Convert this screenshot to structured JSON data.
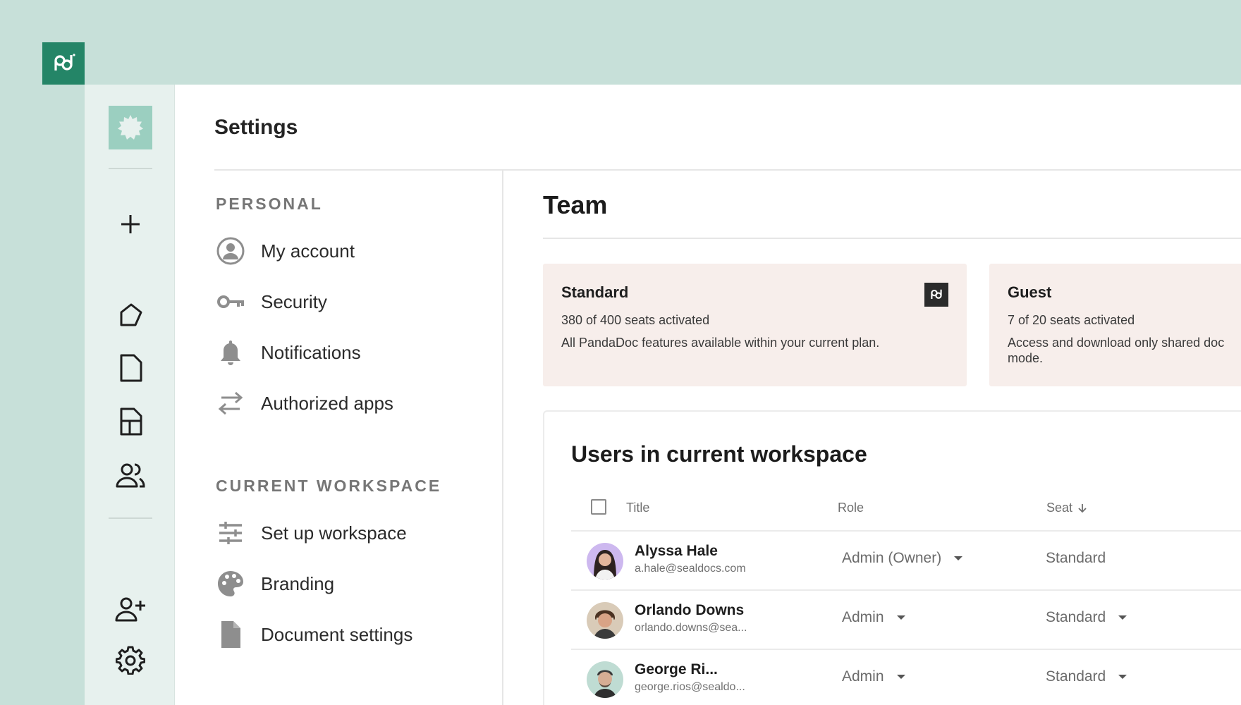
{
  "app": {
    "brand_color": "#248567",
    "background": "#c7e0d9"
  },
  "rail": {
    "items": [
      {
        "name": "create",
        "icon": "plus-icon"
      },
      {
        "name": "home",
        "icon": "home-icon"
      },
      {
        "name": "documents",
        "icon": "document-icon"
      },
      {
        "name": "templates",
        "icon": "template-icon"
      },
      {
        "name": "contacts",
        "icon": "people-icon"
      },
      {
        "name": "invite",
        "icon": "add-user-icon"
      },
      {
        "name": "settings",
        "icon": "gear-icon"
      }
    ]
  },
  "settings": {
    "title": "Settings"
  },
  "nav": {
    "personal_heading": "PERSONAL",
    "personal": [
      {
        "label": "My account",
        "icon": "account-icon"
      },
      {
        "label": "Security",
        "icon": "key-icon"
      },
      {
        "label": "Notifications",
        "icon": "bell-icon"
      },
      {
        "label": "Authorized apps",
        "icon": "arrows-icon"
      }
    ],
    "workspace_heading": "CURRENT WORKSPACE",
    "workspace": [
      {
        "label": "Set up workspace",
        "icon": "sliders-icon"
      },
      {
        "label": "Branding",
        "icon": "palette-icon"
      },
      {
        "label": "Document settings",
        "icon": "file-icon"
      }
    ]
  },
  "team": {
    "title": "Team",
    "plans": [
      {
        "name": "Standard",
        "seats": "380 of 400 seats activated",
        "description": "All PandaDoc features available within your current plan."
      },
      {
        "name": "Guest",
        "seats": "7 of 20 seats activated",
        "description": "Access and download only shared doc mode."
      }
    ]
  },
  "users": {
    "title": "Users in current workspace",
    "columns": {
      "title": "Title",
      "role": "Role",
      "seat": "Seat"
    },
    "rows": [
      {
        "name": "Alyssa Hale",
        "email": "a.hale@sealdocs.com",
        "role": "Admin (Owner)",
        "seat": "Standard",
        "seat_dropdown": false
      },
      {
        "name": "Orlando Downs",
        "email": "orlando.downs@sea...",
        "role": "Admin",
        "seat": "Standard",
        "seat_dropdown": true
      },
      {
        "name": "George Ri...",
        "email": "george.rios@sealdo...",
        "role": "Admin",
        "seat": "Standard",
        "seat_dropdown": true
      }
    ]
  }
}
